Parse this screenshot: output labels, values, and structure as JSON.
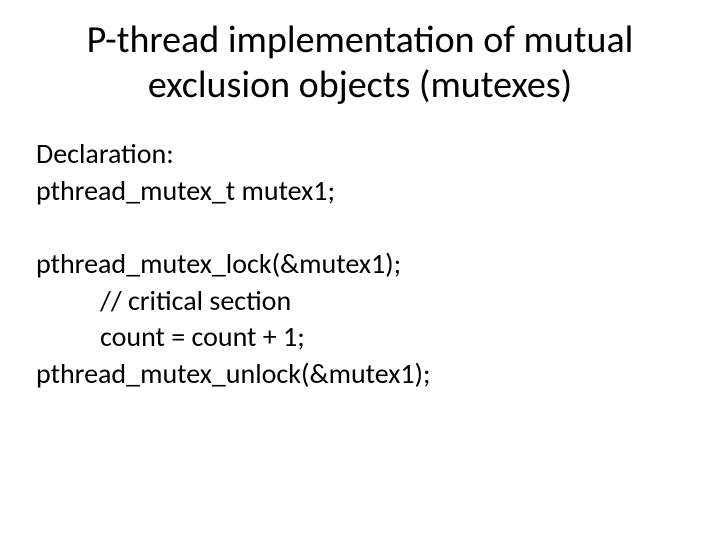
{
  "title_line1": "P-thread implementation of mutual",
  "title_line2": "exclusion objects (mutexes)",
  "body": {
    "l1": "Declaration:",
    "l2": "pthread_mutex_t mutex1;",
    "l3": "pthread_mutex_lock(&mutex1);",
    "l4": "// critical section",
    "l5": "count = count + 1;",
    "l6": "pthread_mutex_unlock(&mutex1);"
  }
}
